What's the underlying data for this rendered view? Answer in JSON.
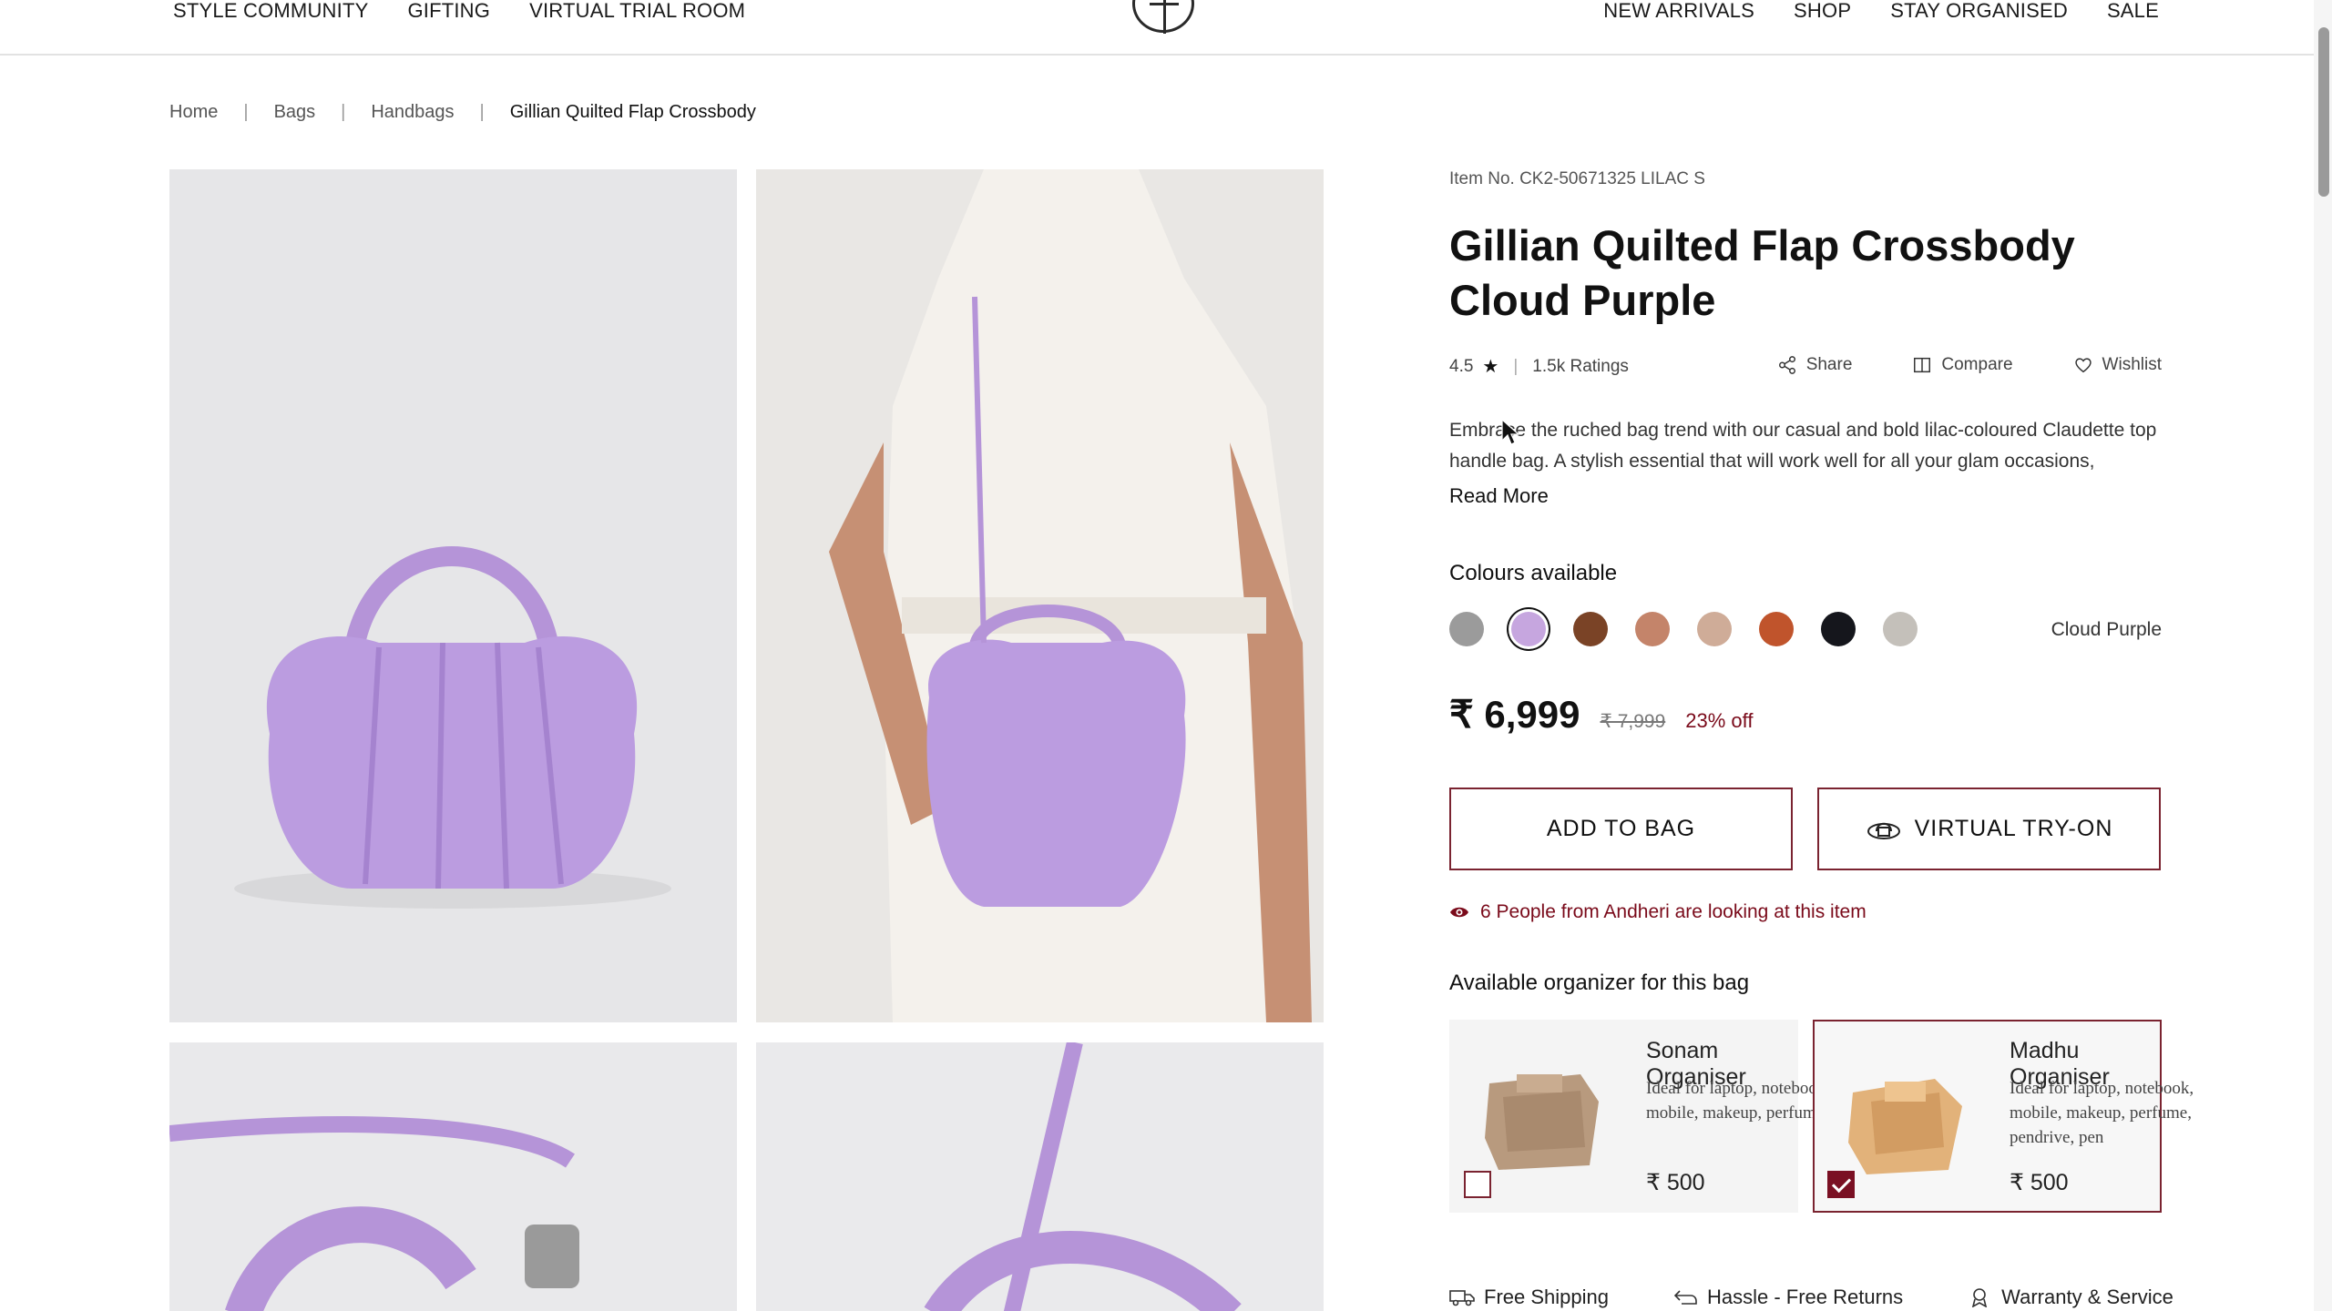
{
  "nav": {
    "left": [
      "STYLE COMMUNITY",
      "GIFTING",
      "VIRTUAL TRIAL ROOM"
    ],
    "right": [
      "NEW ARRIVALS",
      "SHOP",
      "STAY ORGANISED",
      "SALE"
    ]
  },
  "breadcrumb": [
    "Home",
    "Bags",
    "Handbags",
    "Gillian Quilted Flap Crossbody"
  ],
  "product": {
    "item_no": "Item No. CK2-50671325 LILAC S",
    "title": "Gillian Quilted Flap Crossbody Cloud Purple",
    "rating": "4.5",
    "ratings_count": "1.5k Ratings",
    "actions": {
      "share": "Share",
      "compare": "Compare",
      "wishlist": "Wishlist"
    },
    "description": "Embrace the ruched bag trend with our casual and bold lilac-coloured Claudette top handle bag. A stylish essential that will work well for all your glam occasions,",
    "read_more": "Read More",
    "colours_title": "Colours available",
    "swatches": [
      "#9b9b9b",
      "#c6a6df",
      "#7a4326",
      "#c4846a",
      "#cfac98",
      "#c0542c",
      "#15161c",
      "#c4c0ba"
    ],
    "selected_swatch_index": 1,
    "selected_colour_name": "Cloud Purple",
    "price": "₹ 6,999",
    "mrp": "₹ 7,999",
    "discount": "23% off",
    "add_to_bag": "ADD TO BAG",
    "virtual_try_on": "VIRTUAL TRY-ON",
    "looking_text": "6 People from Andheri are looking at this item"
  },
  "organizers": {
    "title": "Available organizer for this bag",
    "items": [
      {
        "name": "Sonam Organiser",
        "desc": "Ideal for laptop, notebook, mobile, makeup, perfume",
        "price": "₹ 500",
        "checked": false
      },
      {
        "name": "Madhu Organiser",
        "desc": "Ideal for laptop, notebook, mobile, makeup, perfume, pendrive, pen",
        "price": "₹ 500",
        "checked": true
      }
    ]
  },
  "perks": [
    "Free Shipping",
    "Hassle - Free Returns",
    "Warranty & Service"
  ],
  "colors": {
    "accent": "#7a2330",
    "offer": "#7a0a1a",
    "bag_lilac": "#b89ad8"
  }
}
